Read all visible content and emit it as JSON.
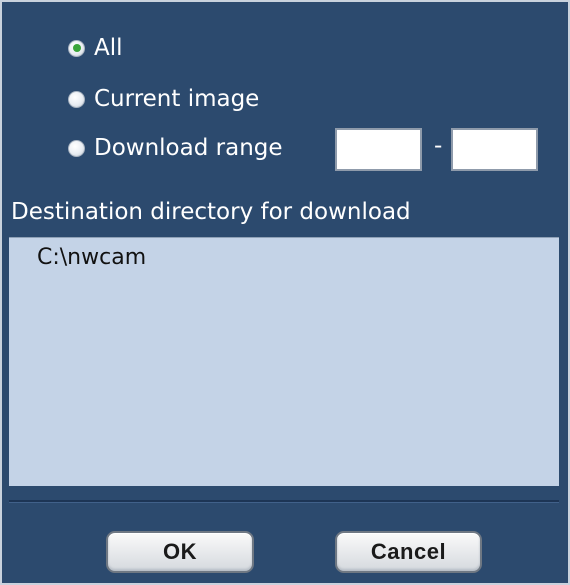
{
  "download_options": {
    "all_label": "All",
    "current_label": "Current image",
    "range_label": "Download range",
    "range_separator": "-",
    "range_start_value": "",
    "range_end_value": "",
    "selected": "All"
  },
  "destination": {
    "label": "Destination directory for download",
    "path": "C:\\nwcam"
  },
  "buttons": {
    "ok_label": "OK",
    "cancel_label": "Cancel"
  },
  "colors": {
    "background": "#2c4a6e",
    "panel": "#c4d3e7",
    "radio_selected": "#3aa53a"
  }
}
